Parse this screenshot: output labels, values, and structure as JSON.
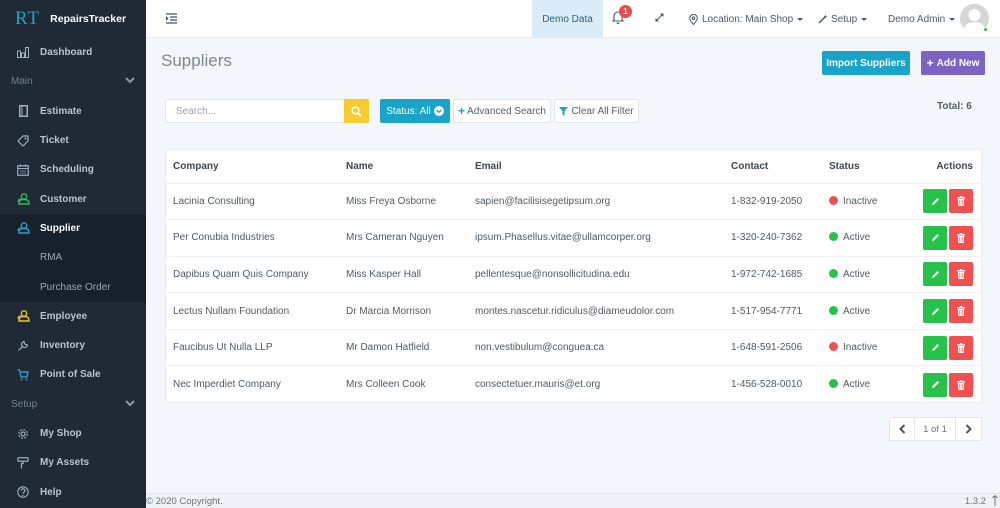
{
  "app": {
    "logo": "RT",
    "name": "RepairsTracker"
  },
  "colors": {
    "sidebar_bg": "#1f2a36",
    "primary": "#1aa3c9",
    "purple": "#7b63c2",
    "warning": "#f8cc2f",
    "success": "#27c24c",
    "danger": "#ef5050"
  },
  "sidebar": {
    "items": [
      {
        "label": "Dashboard",
        "icon": "bar-chart-icon"
      },
      {
        "label": "Main",
        "type": "section"
      },
      {
        "label": "Estimate",
        "icon": "document-icon"
      },
      {
        "label": "Ticket",
        "icon": "tag-icon"
      },
      {
        "label": "Scheduling",
        "icon": "calendar-icon"
      },
      {
        "label": "Customer",
        "icon": "users-icon"
      },
      {
        "label": "Supplier",
        "icon": "users-icon",
        "active": true
      },
      {
        "label": "RMA",
        "type": "sub"
      },
      {
        "label": "Purchase Order",
        "type": "sub"
      },
      {
        "label": "Employee",
        "icon": "users-icon"
      },
      {
        "label": "Inventory",
        "icon": "wrench-icon"
      },
      {
        "label": "Point of Sale",
        "icon": "cart-icon"
      },
      {
        "label": "Setup",
        "type": "section"
      },
      {
        "label": "My Shop",
        "icon": "gear-icon"
      },
      {
        "label": "My Assets",
        "icon": "paint-roller-icon"
      },
      {
        "label": "Help",
        "icon": "help-icon"
      }
    ]
  },
  "topbar": {
    "demo_data": "Demo Data",
    "notification_count": "1",
    "location": "Location: Main Shop",
    "setup": "Setup",
    "user": "Demo Admin"
  },
  "page": {
    "title": "Suppliers",
    "import_button": "Import Suppliers",
    "add_button": "Add New",
    "total": "Total: 6"
  },
  "filters": {
    "search_placeholder": "Search...",
    "search_value": "",
    "status_button": "Status: All",
    "advanced_search": "Advanced Search",
    "clear_filter": "Clear All Filter"
  },
  "table": {
    "headers": {
      "company": "Company",
      "name": "Name",
      "email": "Email",
      "contact": "Contact",
      "status": "Status",
      "actions": "Actions"
    },
    "rows": [
      {
        "company": "Lacinia Consulting",
        "name": "Miss Freya Osborne",
        "email": "sapien@facilisisegetipsum.org",
        "contact": "1-832-919-2050",
        "status": "Inactive"
      },
      {
        "company": "Per Conubia Industries",
        "name": "Mrs Cameran Nguyen",
        "email": "ipsum.Phasellus.vitae@ullamcorper.org",
        "contact": "1-320-240-7362",
        "status": "Active"
      },
      {
        "company": "Dapibus Quam Quis Company",
        "name": "Miss Kasper Hall",
        "email": "pellentesque@nonsollicitudina.edu",
        "contact": "1-972-742-1685",
        "status": "Active"
      },
      {
        "company": "Lectus Nullam Foundation",
        "name": "Dr Marcia Morrison",
        "email": "montes.nascetur.ridiculus@diameudolor.com",
        "contact": "1-517-954-7771",
        "status": "Active"
      },
      {
        "company": "Faucibus Ut Nulla LLP",
        "name": "Mr Damon Hatfield",
        "email": "non.vestibulum@conguea.ca",
        "contact": "1-648-591-2506",
        "status": "Inactive"
      },
      {
        "company": "Nec Imperdiet Company",
        "name": "Mrs Colleen Cook",
        "email": "consectetuer.mauris@et.org",
        "contact": "1-456-528-0010",
        "status": "Active"
      }
    ]
  },
  "pagination": {
    "info": "1 of 1"
  },
  "footer": {
    "copyright": "© 2020 Copyright.",
    "version": "1.3.2"
  }
}
